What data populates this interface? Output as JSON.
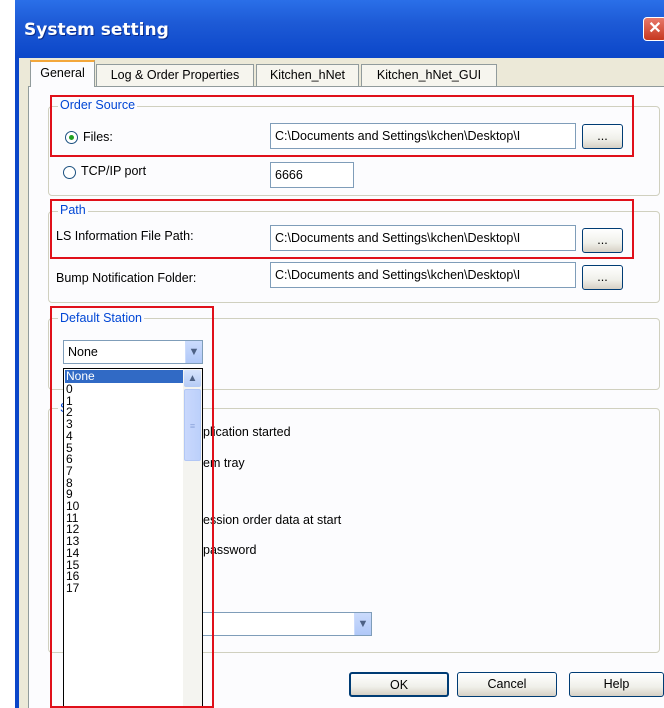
{
  "window": {
    "title": "System setting",
    "close_glyph": "✕"
  },
  "tabs": [
    {
      "label": "General",
      "active": true
    },
    {
      "label": "Log & Order Properties",
      "active": false
    },
    {
      "label": "Kitchen_hNet",
      "active": false
    },
    {
      "label": "Kitchen_hNet_GUI",
      "active": false
    }
  ],
  "order_source": {
    "group_label": "Order Source",
    "files_label": "Files:",
    "files_selected": true,
    "files_path": "C:\\Documents and Settings\\kchen\\Desktop\\I",
    "browse_label": "...",
    "tcp_label": "TCP/IP port",
    "tcp_value": "6666"
  },
  "path": {
    "group_label": "Path",
    "ls_label": "LS Information File Path:",
    "ls_value": "C:\\Documents and Settings\\kchen\\Desktop\\I",
    "bump_label": "Bump Notification Folder:",
    "bump_value": "C:\\Documents and Settings\\kchen\\Desktop\\I",
    "browse_label": "..."
  },
  "default_station": {
    "group_label": "Default Station",
    "selected": "None",
    "options": [
      "None",
      "0",
      "1",
      "2",
      "3",
      "4",
      "5",
      "6",
      "7",
      "8",
      "9",
      "10",
      "11",
      "12",
      "13",
      "14",
      "15",
      "16",
      "17"
    ]
  },
  "other_settings": {
    "group_label_partial": "S",
    "partial_texts": [
      "plication started",
      "em tray",
      "ession order data at start",
      "password"
    ]
  },
  "buttons": {
    "ok": "OK",
    "cancel": "Cancel",
    "help": "Help"
  },
  "colors": {
    "titlebar": "#0b46c9",
    "group_label": "#0046d5",
    "highlight_box": "#e0101a",
    "selection": "#316ac5"
  }
}
